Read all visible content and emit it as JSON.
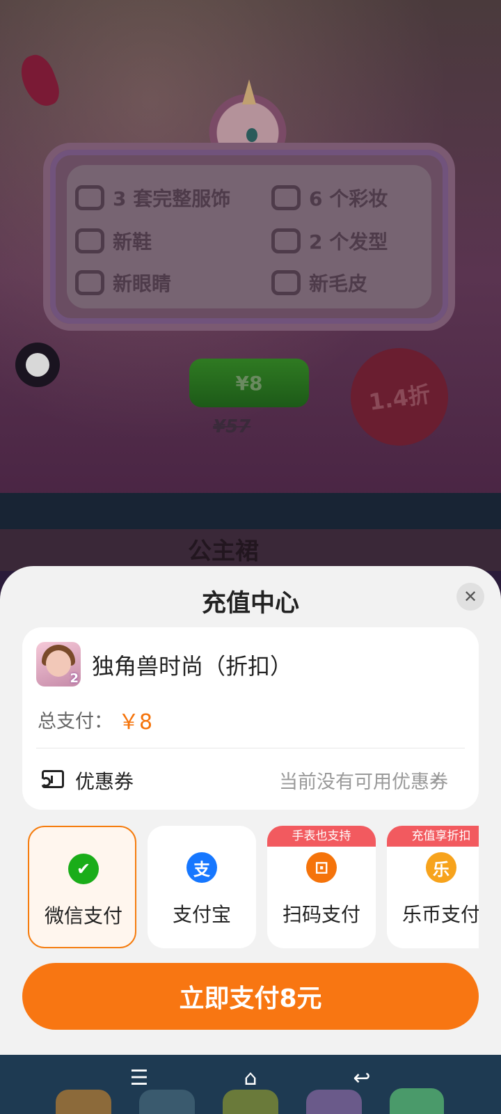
{
  "game": {
    "features": [
      {
        "icon": "shirt-icon",
        "label": "3 套完整服饰"
      },
      {
        "icon": "lipstick-icon",
        "label": "6 个彩妆"
      },
      {
        "icon": "shoe-icon",
        "label": "新鞋"
      },
      {
        "icon": "hair-icon",
        "label": "2 个发型"
      },
      {
        "icon": "eye-icon",
        "label": "新眼睛"
      },
      {
        "icon": "fur-icon",
        "label": "新毛皮"
      }
    ],
    "price": "¥8",
    "original_price": "¥57",
    "discount": "1.4折",
    "section_title": "公主裙"
  },
  "sheet": {
    "title": "充值中心",
    "close_icon": "close-icon",
    "product_name": "独角兽时尚（折扣）",
    "total_label": "总支付：",
    "total_value": "￥8",
    "coupon_label": "优惠券",
    "coupon_status": "当前没有可用优惠券",
    "payment_methods": [
      {
        "label": "微信支付",
        "icon": "wechat-pay-icon",
        "tag": "",
        "selected": true,
        "color": "#1aad19"
      },
      {
        "label": "支付宝",
        "icon": "alipay-icon",
        "tag": "",
        "selected": false,
        "color": "#1677ff"
      },
      {
        "label": "扫码支付",
        "icon": "scan-icon",
        "tag": "手表也支持",
        "selected": false,
        "color": "#f5730a"
      },
      {
        "label": "乐币支付",
        "icon": "lebi-icon",
        "tag": "充值享折扣",
        "selected": false,
        "color": "#f7a31c"
      }
    ],
    "pay_button": "立即支付8元"
  },
  "colors": {
    "accent": "#f87612",
    "price": "#f5730a",
    "tag": "#f25a5f"
  },
  "nav": [
    "menu-icon",
    "home-icon",
    "back-icon"
  ]
}
